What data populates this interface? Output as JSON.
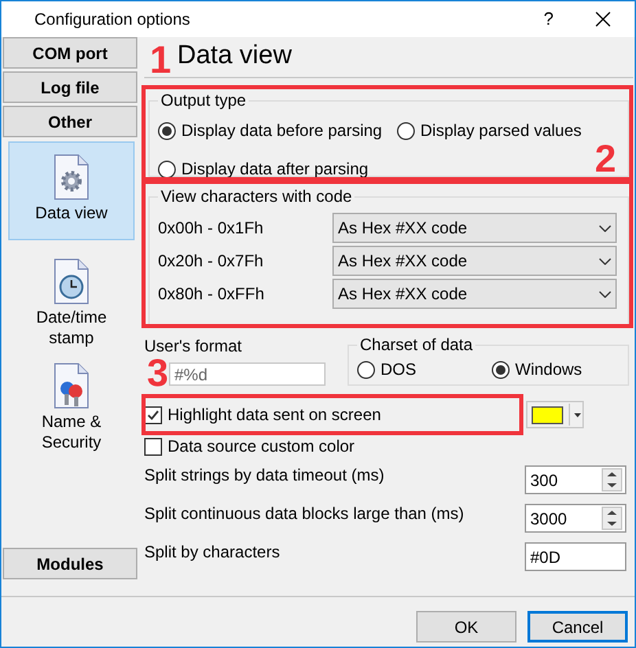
{
  "window": {
    "title": "Configuration options",
    "help": "?"
  },
  "sidebar": {
    "sections": [
      "COM port",
      "Log file",
      "Other"
    ],
    "items": [
      {
        "label": "Data view",
        "kind": "gear",
        "selected": true
      },
      {
        "label": "Date/time stamp",
        "kind": "clock",
        "selected": false
      },
      {
        "label": "Name & Security",
        "kind": "keys",
        "selected": false
      }
    ],
    "bottom_section": "Modules"
  },
  "heading": "Data view",
  "output_type": {
    "title": "Output type",
    "options": [
      {
        "label": "Display data before parsing",
        "selected": true
      },
      {
        "label": "Display parsed values",
        "selected": false
      },
      {
        "label": "Display data after parsing",
        "selected": false
      }
    ]
  },
  "view_characters": {
    "title": "View characters with code",
    "rows": [
      {
        "range": "0x00h - 0x1Fh",
        "value": "As Hex #XX code"
      },
      {
        "range": "0x20h - 0x7Fh",
        "value": "As Hex #XX code"
      },
      {
        "range": "0x80h - 0xFFh",
        "value": "As Hex #XX code"
      }
    ]
  },
  "users_format": {
    "label": "User's format",
    "value": "#%d"
  },
  "charset": {
    "title": "Charset of data",
    "options": [
      {
        "label": "DOS",
        "selected": false
      },
      {
        "label": "Windows",
        "selected": true
      }
    ]
  },
  "highlight": {
    "label": "Highlight data sent on screen",
    "checked": true,
    "color": "#ffff00"
  },
  "custom_color": {
    "label": "Data source custom color",
    "checked": false
  },
  "fields": [
    {
      "label": "Split strings by data timeout (ms)",
      "value": "300",
      "kind": "spin"
    },
    {
      "label": "Split continuous data blocks large than (ms)",
      "value": "3000",
      "kind": "spin"
    },
    {
      "label": "Split by characters",
      "value": "#0D",
      "kind": "text"
    }
  ],
  "buttons": [
    {
      "label": "OK",
      "default": false
    },
    {
      "label": "Cancel",
      "default": true
    }
  ],
  "annotations": [
    "1",
    "2",
    "3"
  ]
}
